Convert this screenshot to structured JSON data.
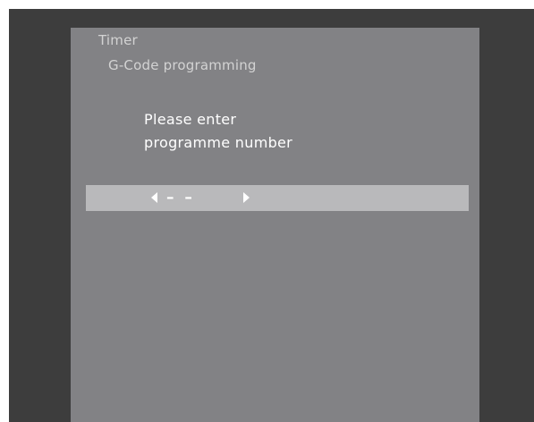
{
  "menu": {
    "title": "Timer",
    "subtitle": "G-Code programming"
  },
  "prompt": {
    "line1": "Please enter",
    "line2": "programme number"
  },
  "input": {
    "value": "– –"
  },
  "icons": {
    "left": "arrow-left-icon",
    "right": "arrow-right-icon"
  },
  "colors": {
    "frame": "#3d3d3d",
    "panel": "#828285",
    "input_bar": "#b9b9bb",
    "text": "#ffffff",
    "breadcrumb_text": "#d3d3d3"
  }
}
